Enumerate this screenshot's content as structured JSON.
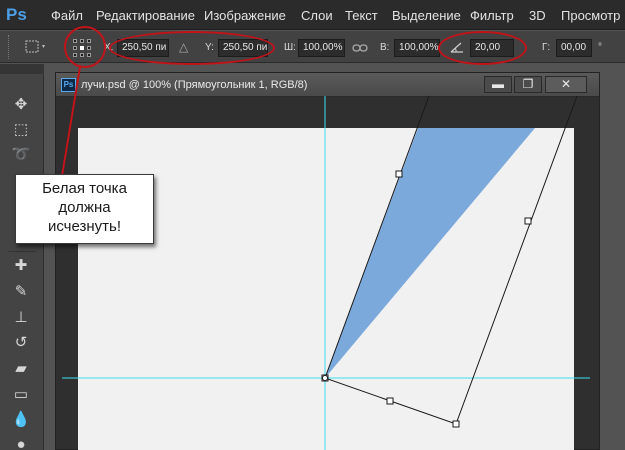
{
  "app": {
    "logo": "Ps"
  },
  "menu": [
    "Файл",
    "Редактирование",
    "Изображение",
    "Слои",
    "Текст",
    "Выделение",
    "Фильтр",
    "3D",
    "Просмотр"
  ],
  "options": {
    "x_label": "X:",
    "x_value": "250,50 пи",
    "y_label": "Y:",
    "y_value": "250,50 пи",
    "w_label": "Ш:",
    "w_value": "100,00%",
    "h_label": "В:",
    "h_value": "100,00%",
    "angle_value": "20,00",
    "hskew_label": "Г:",
    "hskew_value": "00,00",
    "degree_unit": "°"
  },
  "document": {
    "title": "лучи.psd @ 100% (Прямоугольник 1, RGB/8)",
    "minimize": "▬",
    "restore": "❐",
    "close": "✕"
  },
  "callout": {
    "text": "Белая точка\nдолжна\nисчезнуть!"
  },
  "colors": {
    "shape_fill": "#7ba9dc",
    "guide": "#3ee0f0",
    "annotation_red": "#c0141a",
    "canvas": "#f1f1f1"
  },
  "tools": [
    "move-tool",
    "marquee-tool",
    "lasso-tool",
    "healing-brush-tool",
    "brush-tool",
    "clone-stamp-tool",
    "history-brush-tool",
    "eraser-tool",
    "gradient-tool",
    "blur-tool",
    "dodge-tool"
  ]
}
